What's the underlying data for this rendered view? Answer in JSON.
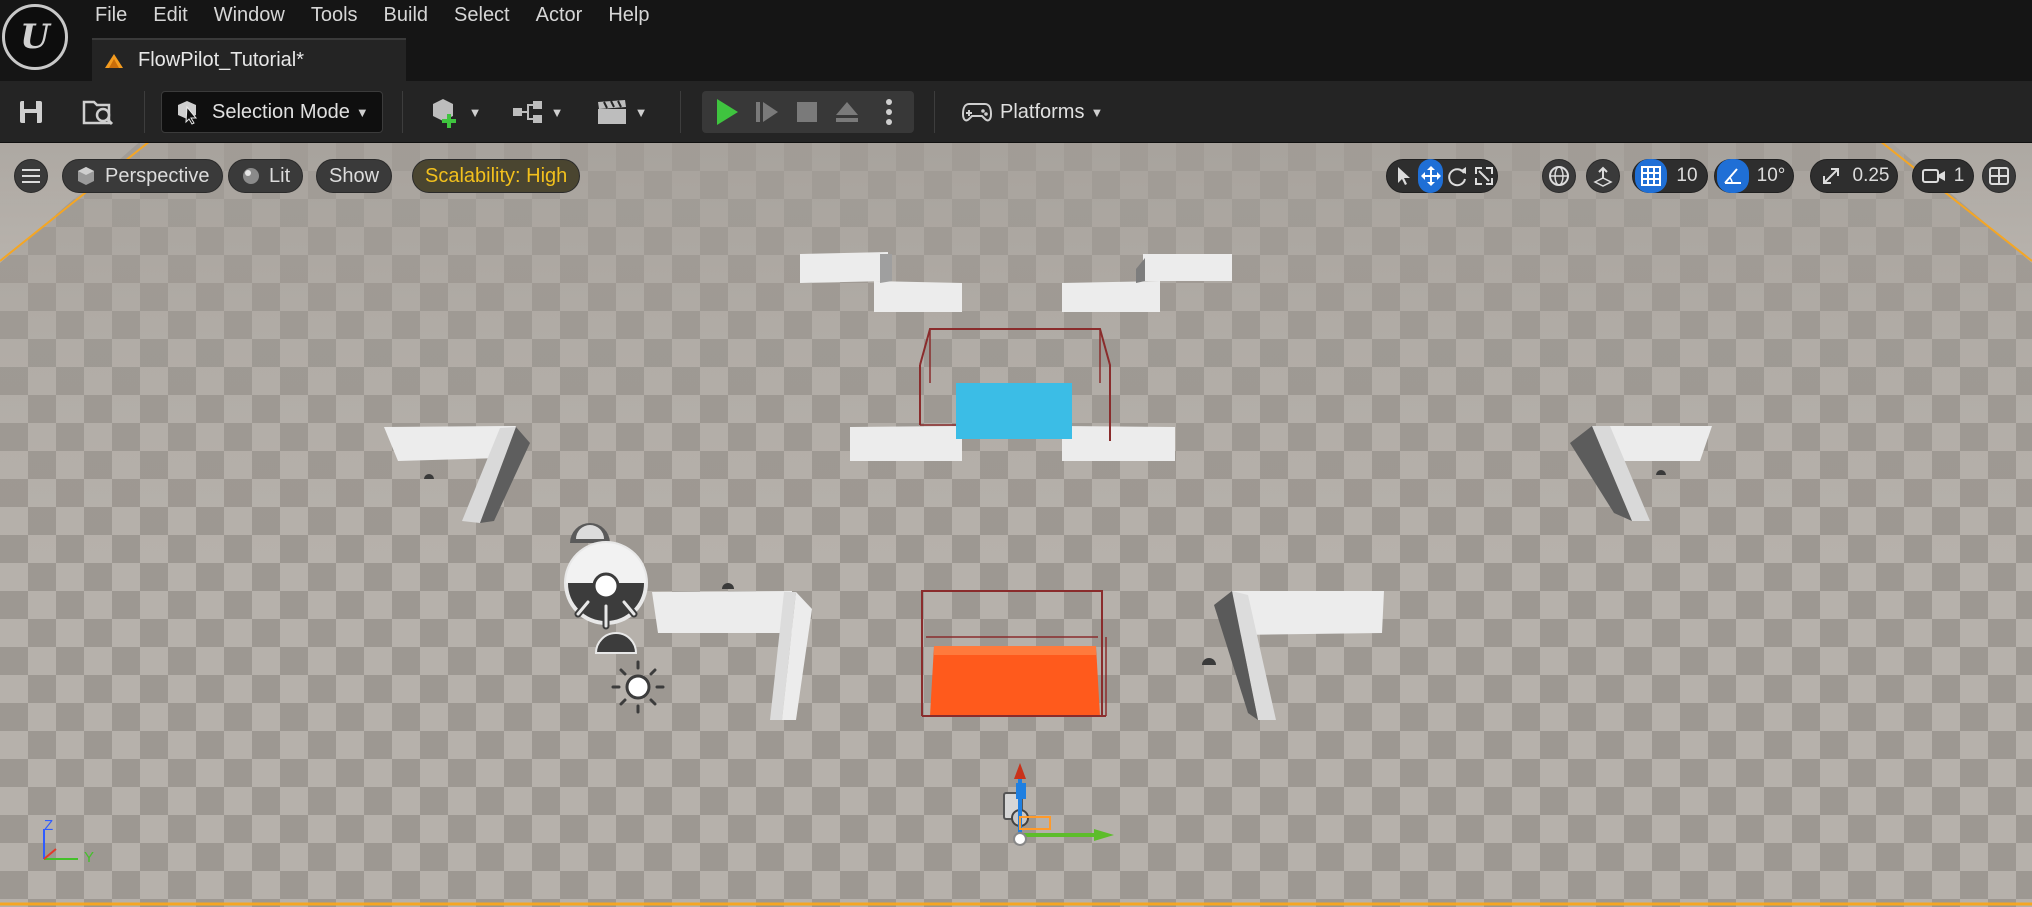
{
  "app": {
    "logo": "unreal-engine-logo",
    "menu": [
      "File",
      "Edit",
      "Window",
      "Tools",
      "Build",
      "Select",
      "Actor",
      "Help"
    ],
    "document_tab": "FlowPilot_Tutorial*"
  },
  "toolbar": {
    "save_icon": "save-icon",
    "content_browser_icon": "content-browser-icon",
    "selection_mode": "Selection Mode",
    "platforms": "Platforms",
    "play_color": "#3fc43f"
  },
  "viewport": {
    "perspective": "Perspective",
    "lit": "Lit",
    "show": "Show",
    "scalability": "Scalability: High",
    "grid_snap": "10",
    "rotation_snap": "10°",
    "scale_snap": "0.25",
    "camera_speed": "1",
    "axis": {
      "z": "Z",
      "y": "Y"
    },
    "colors": {
      "blue_pad": "#3bbde6",
      "orange_pad": "#ff5a1c",
      "selection_outline": "#f5a623"
    }
  }
}
